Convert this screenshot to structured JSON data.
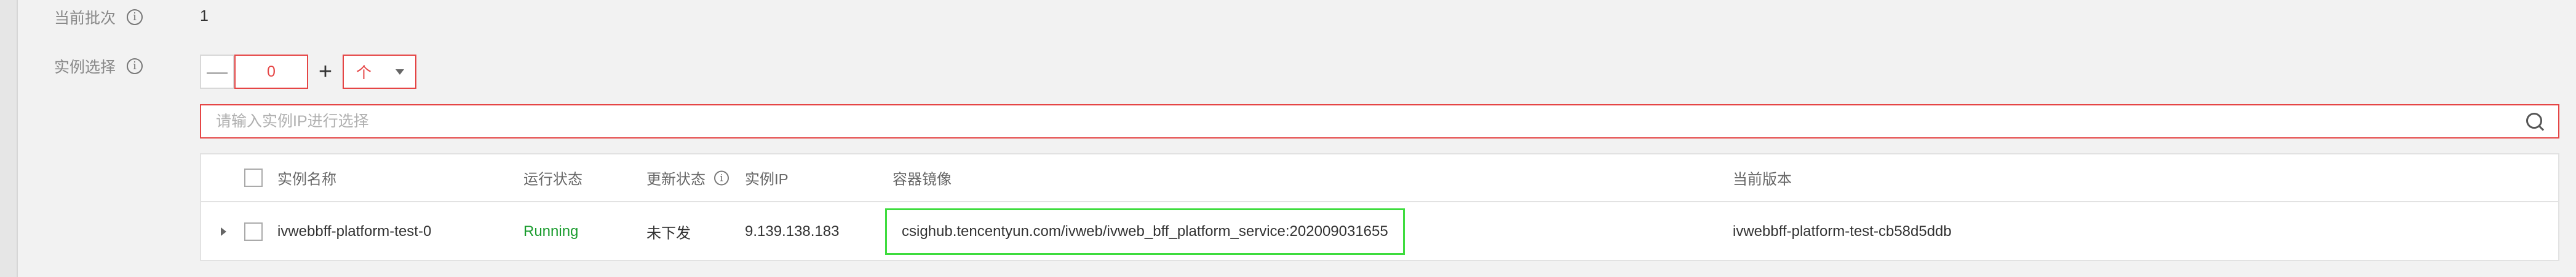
{
  "form": {
    "current_batch_label": "当前批次",
    "current_batch_value": "1",
    "instance_select_label": "实例选择"
  },
  "stepper": {
    "minus": "—",
    "value": "0",
    "plus": "+",
    "unit": "个"
  },
  "search": {
    "placeholder": "请输入实例IP进行选择"
  },
  "table": {
    "headers": {
      "name": "实例名称",
      "run_status": "运行状态",
      "update_status": "更新状态",
      "ip": "实例IP",
      "image": "容器镜像",
      "version": "当前版本"
    },
    "rows": [
      {
        "name": "ivwebbff-platform-test-0",
        "run_status": "Running",
        "update_status": "未下发",
        "ip": "9.139.138.183",
        "image": "csighub.tencentyun.com/ivweb/ivweb_bff_platform_service:202009031655",
        "version": "ivwebbff-platform-test-cb58d5ddb"
      }
    ]
  },
  "icons": {
    "info": "info-circle-icon",
    "search": "search-icon",
    "caret": "chevron-down-icon",
    "expand": "caret-right-icon"
  },
  "colors": {
    "error_border": "#e54545",
    "running": "#1a9c2e",
    "highlight": "#3ddc3d"
  }
}
